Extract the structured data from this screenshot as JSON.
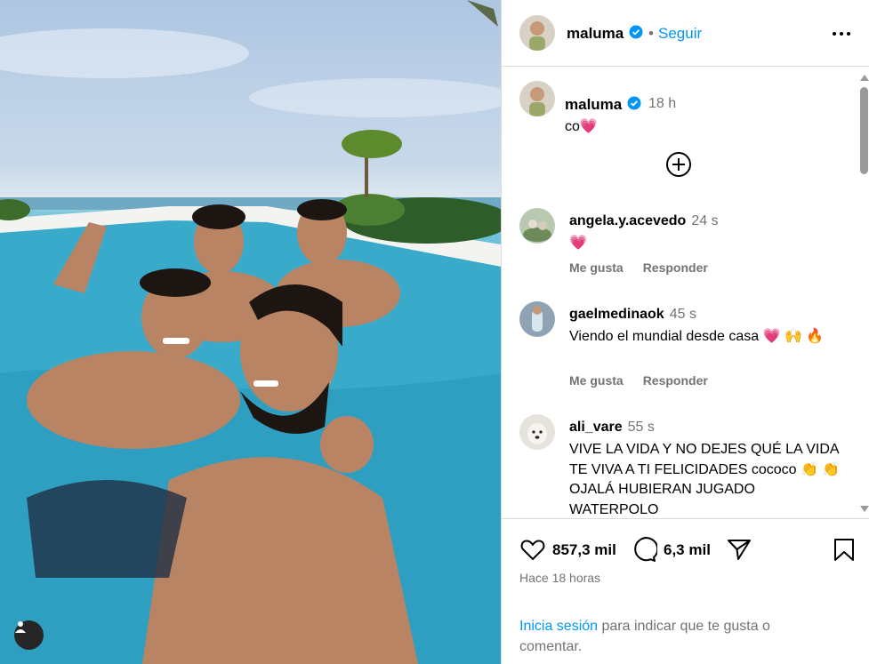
{
  "post": {
    "author": "maluma",
    "follow_label": "Seguir",
    "dot": "•"
  },
  "caption": {
    "author": "maluma",
    "time": "18 h",
    "text": "co💗"
  },
  "comments": [
    {
      "user": "angela.y.acevedo",
      "time": "24 s",
      "text": "💗",
      "like_label": "Me gusta",
      "reply_label": "Responder"
    },
    {
      "user": "gaelmedinaok",
      "time": "45 s",
      "text": "Viendo el mundial desde casa 💗 🙌 🔥",
      "like_label": "Me gusta",
      "reply_label": "Responder"
    },
    {
      "user": "ali_vare",
      "time": "55 s",
      "text": "VIVE LA VIDA Y NO DEJES QUÉ LA VIDA TE VIVA A TI FELICIDADES cococo 👏 👏 OJALÁ HUBIERAN JUGADO WATERPOLO"
    }
  ],
  "footer": {
    "likes": "857,3 mil",
    "comments": "6,3 mil",
    "time_ago": "Hace 18 horas",
    "login_link": "Inicia sesión",
    "login_text": " para indicar que te gusta o comentar."
  },
  "icons": {
    "verified": "verified-badge-icon",
    "more": "more-options-icon",
    "load_more": "plus-circle-icon",
    "like": "heart-icon",
    "comment": "comment-bubble-icon",
    "share": "paper-plane-icon",
    "save": "bookmark-icon",
    "user_tag": "person-icon"
  },
  "colors": {
    "accent": "#0095f6",
    "verified": "#0095f6",
    "muted": "#737373",
    "border": "#dbdbdb"
  }
}
